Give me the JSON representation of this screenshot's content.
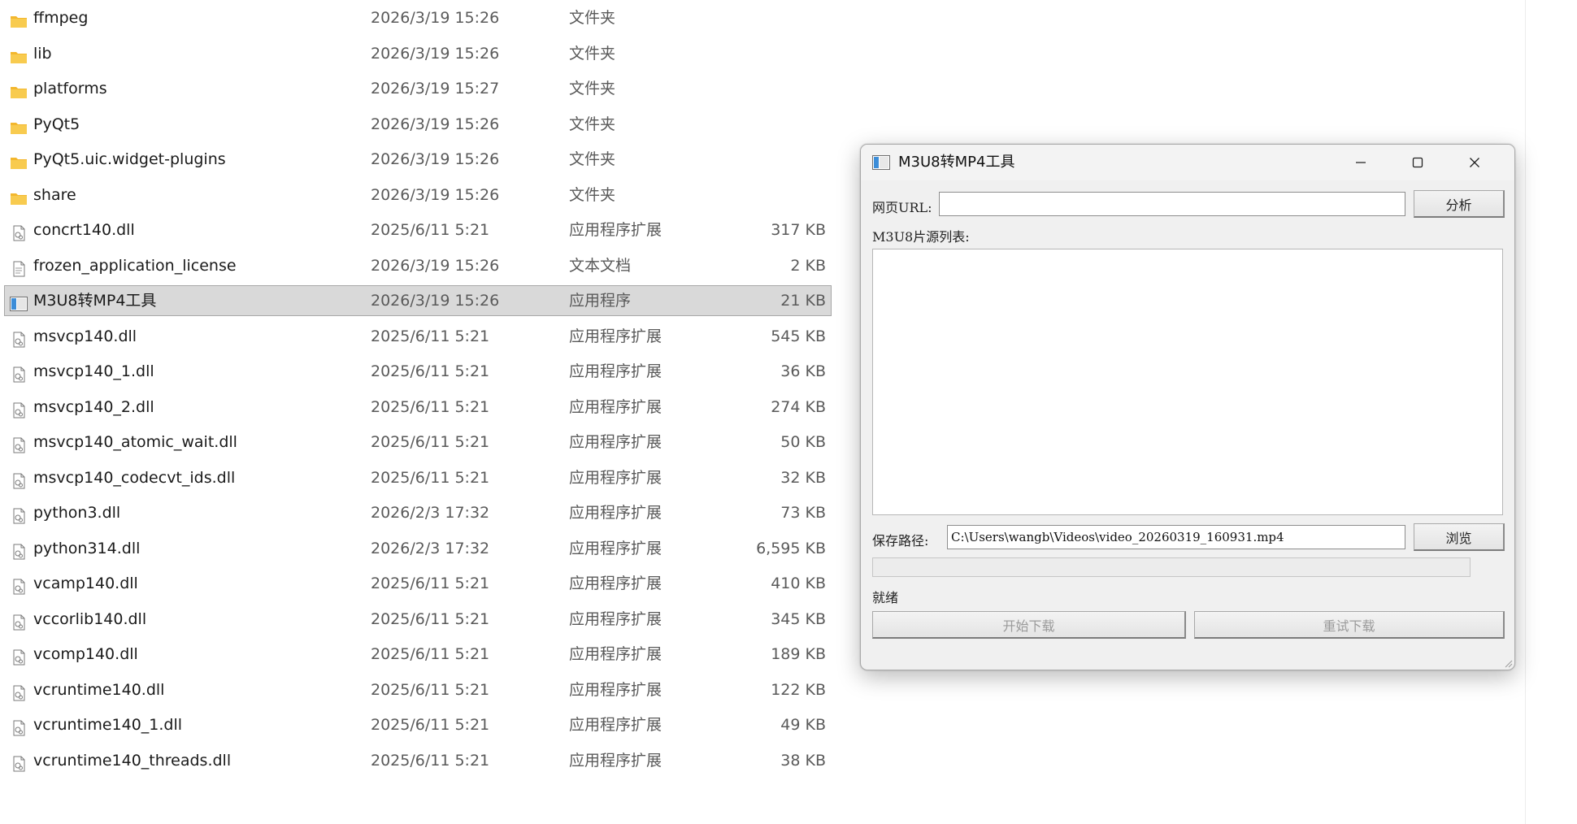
{
  "explorer": {
    "files": [
      {
        "name": "ffmpeg",
        "date": "2026/3/19 15:26",
        "type": "文件夹",
        "size": "",
        "icon": "folder-icon"
      },
      {
        "name": "lib",
        "date": "2026/3/19 15:26",
        "type": "文件夹",
        "size": "",
        "icon": "folder-icon"
      },
      {
        "name": "platforms",
        "date": "2026/3/19 15:27",
        "type": "文件夹",
        "size": "",
        "icon": "folder-icon"
      },
      {
        "name": "PyQt5",
        "date": "2026/3/19 15:26",
        "type": "文件夹",
        "size": "",
        "icon": "folder-icon"
      },
      {
        "name": "PyQt5.uic.widget-plugins",
        "date": "2026/3/19 15:26",
        "type": "文件夹",
        "size": "",
        "icon": "folder-icon"
      },
      {
        "name": "share",
        "date": "2026/3/19 15:26",
        "type": "文件夹",
        "size": "",
        "icon": "folder-icon"
      },
      {
        "name": "concrt140.dll",
        "date": "2025/6/11 5:21",
        "type": "应用程序扩展",
        "size": "317 KB",
        "icon": "dll-icon"
      },
      {
        "name": "frozen_application_license",
        "date": "2026/3/19 15:26",
        "type": "文本文档",
        "size": "2 KB",
        "icon": "text-file-icon"
      },
      {
        "name": "M3U8转MP4工具",
        "date": "2026/3/19 15:26",
        "type": "应用程序",
        "size": "21 KB",
        "icon": "app-icon",
        "selected": true
      },
      {
        "name": "msvcp140.dll",
        "date": "2025/6/11 5:21",
        "type": "应用程序扩展",
        "size": "545 KB",
        "icon": "dll-icon"
      },
      {
        "name": "msvcp140_1.dll",
        "date": "2025/6/11 5:21",
        "type": "应用程序扩展",
        "size": "36 KB",
        "icon": "dll-icon"
      },
      {
        "name": "msvcp140_2.dll",
        "date": "2025/6/11 5:21",
        "type": "应用程序扩展",
        "size": "274 KB",
        "icon": "dll-icon"
      },
      {
        "name": "msvcp140_atomic_wait.dll",
        "date": "2025/6/11 5:21",
        "type": "应用程序扩展",
        "size": "50 KB",
        "icon": "dll-icon"
      },
      {
        "name": "msvcp140_codecvt_ids.dll",
        "date": "2025/6/11 5:21",
        "type": "应用程序扩展",
        "size": "32 KB",
        "icon": "dll-icon"
      },
      {
        "name": "python3.dll",
        "date": "2026/2/3 17:32",
        "type": "应用程序扩展",
        "size": "73 KB",
        "icon": "dll-icon"
      },
      {
        "name": "python314.dll",
        "date": "2026/2/3 17:32",
        "type": "应用程序扩展",
        "size": "6,595 KB",
        "icon": "dll-icon"
      },
      {
        "name": "vcamp140.dll",
        "date": "2025/6/11 5:21",
        "type": "应用程序扩展",
        "size": "410 KB",
        "icon": "dll-icon"
      },
      {
        "name": "vccorlib140.dll",
        "date": "2025/6/11 5:21",
        "type": "应用程序扩展",
        "size": "345 KB",
        "icon": "dll-icon"
      },
      {
        "name": "vcomp140.dll",
        "date": "2025/6/11 5:21",
        "type": "应用程序扩展",
        "size": "189 KB",
        "icon": "dll-icon"
      },
      {
        "name": "vcruntime140.dll",
        "date": "2025/6/11 5:21",
        "type": "应用程序扩展",
        "size": "122 KB",
        "icon": "dll-icon"
      },
      {
        "name": "vcruntime140_1.dll",
        "date": "2025/6/11 5:21",
        "type": "应用程序扩展",
        "size": "49 KB",
        "icon": "dll-icon"
      },
      {
        "name": "vcruntime140_threads.dll",
        "date": "2025/6/11 5:21",
        "type": "应用程序扩展",
        "size": "38 KB",
        "icon": "dll-icon"
      }
    ]
  },
  "app": {
    "title": "M3U8转MP4工具",
    "url_label": "网页URL:",
    "url_value": "",
    "analyze_label": "分析",
    "sources_label": "M3U8片源列表:",
    "sources": [],
    "save_path_label": "保存路径:",
    "save_path_value": "C:\\Users\\wangb\\Videos\\video_20260319_160931.mp4",
    "browse_label": "浏览",
    "progress": 0,
    "status": "就绪",
    "start_label": "开始下载",
    "retry_label": "重试下载"
  },
  "colors": {
    "selection": "#d9d9d9",
    "folder": "#f6c342",
    "window_bg": "#f0f0f0",
    "progress": "#06b025"
  }
}
